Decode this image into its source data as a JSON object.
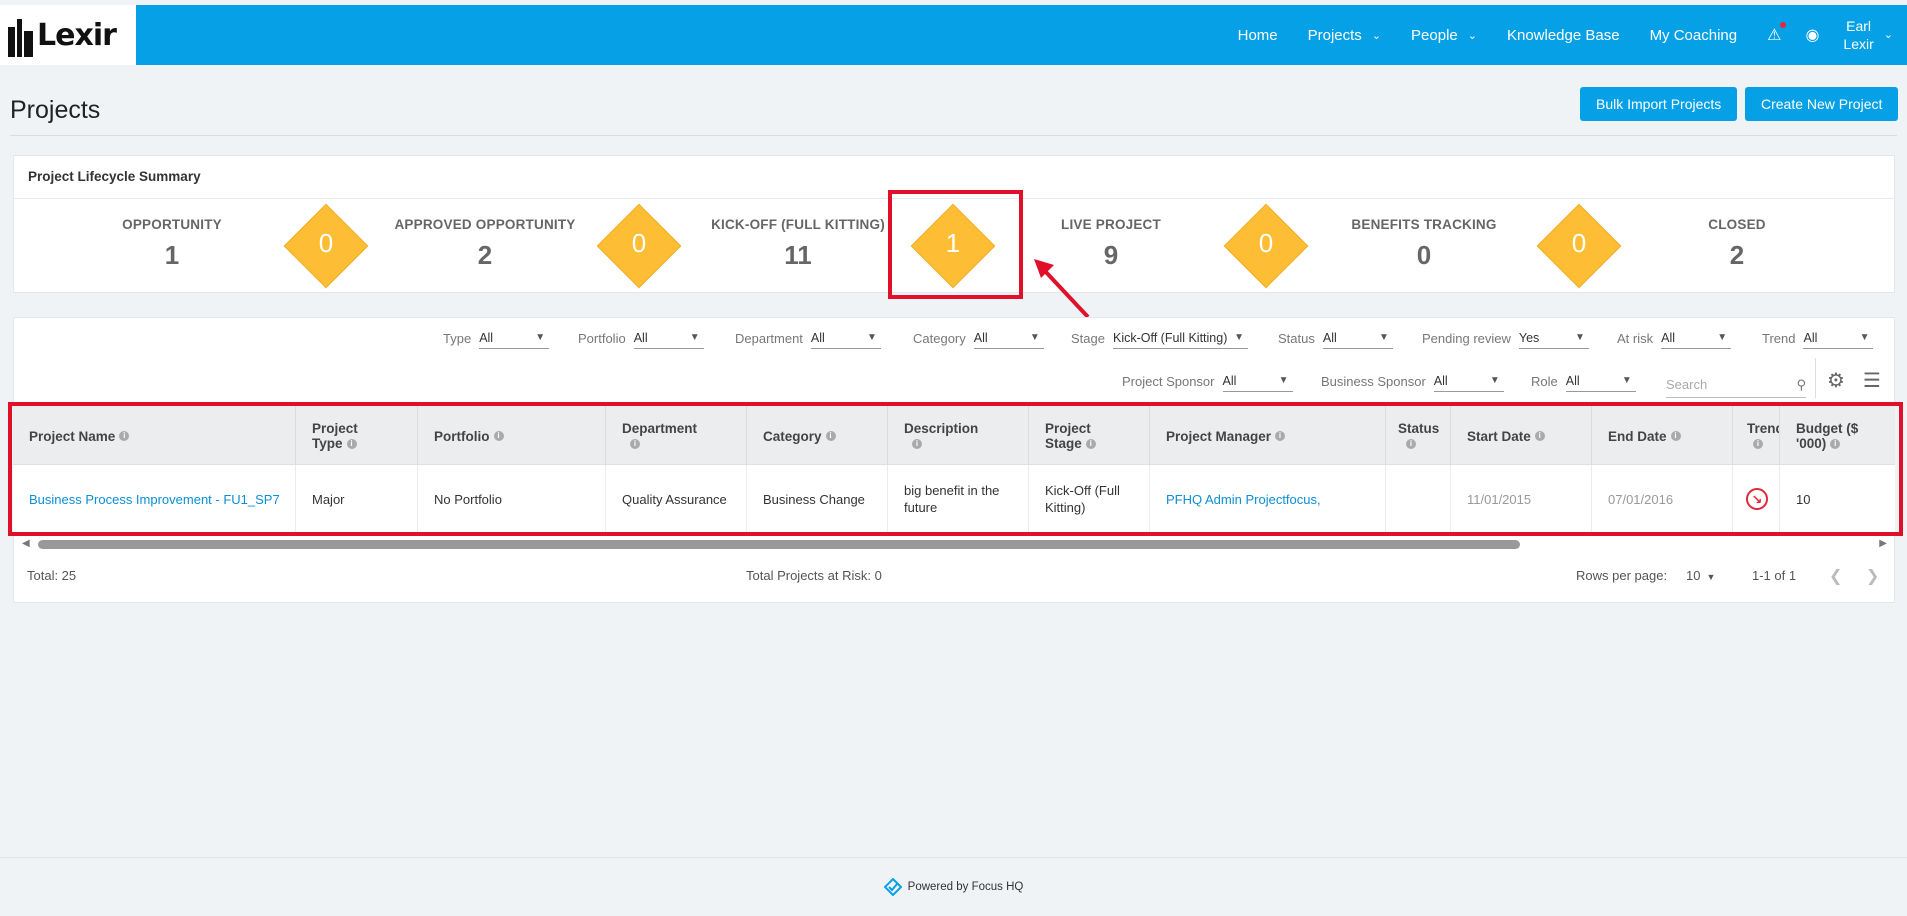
{
  "header": {
    "logo_text": "Lexir",
    "nav": {
      "home": "Home",
      "projects": "Projects",
      "people": "People",
      "knowledge_base": "Knowledge Base",
      "my_coaching": "My Coaching"
    },
    "user": {
      "first": "Earl",
      "last": "Lexir"
    }
  },
  "page": {
    "title": "Projects",
    "bulk_import_label": "Bulk Import Projects",
    "create_new_label": "Create New Project"
  },
  "lifecycle": {
    "title": "Project Lifecycle Summary",
    "stages": [
      {
        "label": "OPPORTUNITY",
        "count": "1"
      },
      {
        "label": "APPROVED OPPORTUNITY",
        "count": "2"
      },
      {
        "label": "KICK-OFF (FULL KITTING)",
        "count": "11"
      },
      {
        "label": "LIVE PROJECT",
        "count": "9"
      },
      {
        "label": "BENEFITS TRACKING",
        "count": "0"
      },
      {
        "label": "CLOSED",
        "count": "2"
      }
    ],
    "transitions": [
      "0",
      "0",
      "1",
      "0",
      "0"
    ],
    "transition_color": "#fdbd34"
  },
  "filters": {
    "type": {
      "label": "Type",
      "value": "All"
    },
    "portfolio": {
      "label": "Portfolio",
      "value": "All"
    },
    "department": {
      "label": "Department",
      "value": "All"
    },
    "category": {
      "label": "Category",
      "value": "All"
    },
    "stage": {
      "label": "Stage",
      "value": "Kick-Off (Full Kitting)"
    },
    "status": {
      "label": "Status",
      "value": "All"
    },
    "pending_review": {
      "label": "Pending review",
      "value": "Yes"
    },
    "at_risk": {
      "label": "At risk",
      "value": "All"
    },
    "trend": {
      "label": "Trend",
      "value": "All"
    },
    "project_sponsor": {
      "label": "Project Sponsor",
      "value": "All"
    },
    "business_sponsor": {
      "label": "Business Sponsor",
      "value": "All"
    },
    "role": {
      "label": "Role",
      "value": "All"
    },
    "search_placeholder": "Search"
  },
  "table": {
    "columns": {
      "project_name": "Project Name",
      "project_type_1": "Project",
      "project_type_2": "Type",
      "portfolio": "Portfolio",
      "department": "Department",
      "category": "Category",
      "description": "Description",
      "project_stage_1": "Project",
      "project_stage_2": "Stage",
      "project_manager": "Project Manager",
      "status": "Status",
      "start_date": "Start Date",
      "end_date": "End Date",
      "trend": "Trend",
      "budget_1": "Budget ($",
      "budget_2": "'000)"
    },
    "rows": [
      {
        "project_name": "Business Process Improvement - FU1_SP7",
        "project_type": "Major",
        "portfolio": "No Portfolio",
        "department": "Quality Assurance",
        "category": "Business Change",
        "description_1": "big benefit in the",
        "description_2": "future",
        "stage_1": "Kick-Off (Full",
        "stage_2": "Kitting)",
        "project_manager": "PFHQ Admin Projectfocus,",
        "status": "",
        "start_date": "11/01/2015",
        "end_date": "07/01/2016",
        "trend": "down-right-arrow",
        "budget": "10"
      }
    ]
  },
  "table_footer": {
    "total": "Total: 25",
    "at_risk": "Total Projects at Risk: 0",
    "rows_per_page_label": "Rows per page:",
    "rows_per_page_value": "10",
    "range": "1-1 of 1"
  },
  "footer": {
    "powered_by": "Powered by Focus HQ"
  },
  "colors": {
    "brand": "#05a0e6",
    "highlight": "#e0102b"
  }
}
